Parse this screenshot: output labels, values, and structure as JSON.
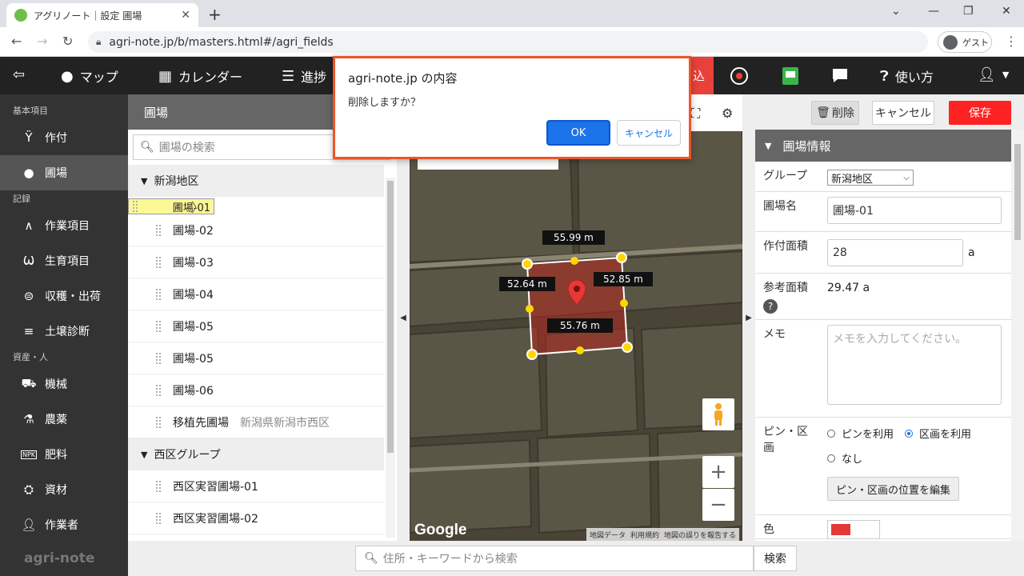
{
  "browser": {
    "tab_title": "アグリノート｜設定 圃場",
    "url": "agri-note.jp/b/masters.html#/agri_fields",
    "guest_label": "ゲスト"
  },
  "topnav": {
    "map": "マップ",
    "calendar": "カレンダー",
    "progress": "進捗",
    "red_tab": "込",
    "help": "使い方"
  },
  "sidebar": {
    "sections": {
      "basic": "基本項目",
      "records": "記録",
      "assets": "資産・人"
    },
    "items": {
      "crop": "作付",
      "field": "圃場",
      "work_item": "作業項目",
      "growth_item": "生育項目",
      "harvest": "収穫・出荷",
      "soil": "土壌診断",
      "machine": "機械",
      "pesticide": "農薬",
      "fertilizer": "肥料",
      "material": "資材",
      "worker": "作業者"
    },
    "brand": "agri-note"
  },
  "field_list": {
    "title": "圃場",
    "search_placeholder": "圃場の検索",
    "groups": [
      {
        "name": "新潟地区",
        "fields": [
          {
            "name": "圃場-01",
            "sub": ""
          },
          {
            "name": "圃場-02",
            "sub": ""
          },
          {
            "name": "圃場-03",
            "sub": ""
          },
          {
            "name": "圃場-04",
            "sub": ""
          },
          {
            "name": "圃場-05",
            "sub": ""
          },
          {
            "name": "圃場-05",
            "sub": ""
          },
          {
            "name": "圃場-06",
            "sub": ""
          },
          {
            "name": "移植先圃場",
            "sub": "新潟県新潟市西区"
          }
        ]
      },
      {
        "name": "西区グループ",
        "fields": [
          {
            "name": "西区実習圃場-01",
            "sub": ""
          },
          {
            "name": "西区実習圃場-02",
            "sub": ""
          }
        ]
      }
    ]
  },
  "map": {
    "measurements": {
      "top": "55.99 m",
      "left": "52.64 m",
      "right": "52.85 m",
      "bottom": "55.76 m"
    },
    "google": "Google",
    "footer": [
      "地図データ",
      "利用規約",
      "地図の誤りを報告する"
    ],
    "zoom_in": "+",
    "zoom_out": "−"
  },
  "address_search": {
    "placeholder": "住所・キーワードから検索",
    "button": "検索"
  },
  "field_info": {
    "buttons": {
      "delete": "削除",
      "cancel": "キャンセル",
      "save": "保存"
    },
    "section_title": "圃場情報",
    "labels": {
      "group": "グループ",
      "name": "圃場名",
      "area": "作付面積",
      "ref_area": "参考面積",
      "memo": "メモ",
      "pin": "ピン・区画",
      "color": "色"
    },
    "values": {
      "group": "新潟地区",
      "name": "圃場-01",
      "area": "28",
      "area_unit": "a",
      "ref_area": "29.47 a",
      "memo_placeholder": "メモを入力してください。"
    },
    "pin_options": {
      "pin": "ピンを利用",
      "section": "区画を利用",
      "none": "なし"
    },
    "pin_edit_button": "ピン・区画の位置を編集",
    "color_value": "#e53935"
  },
  "dialog": {
    "title": "agri-note.jp の内容",
    "message": "削除しますか？",
    "ok": "OK",
    "cancel": "キャンセル"
  }
}
